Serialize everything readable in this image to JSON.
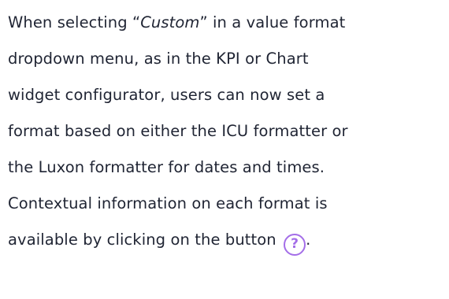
{
  "paragraph": {
    "line1": {
      "before": "When selecting ",
      "quote_open": "“",
      "italic": "Custom",
      "quote_close": "”",
      "after": " in a value format"
    },
    "line2": "dropdown menu, as in the KPI or Chart",
    "line3": "widget configurator, users can now set a",
    "line4": "format based on either the ICU formatter or",
    "line5": "the Luxon formatter for dates and times.",
    "line6": "Contextual information on each format is",
    "line7": {
      "text": "available by clicking on the button ",
      "icon_glyph": "?",
      "end": "."
    }
  },
  "icons": {
    "help": "question-circle-icon"
  },
  "colors": {
    "text": "#1f2433",
    "accent": "#a46ee8"
  }
}
